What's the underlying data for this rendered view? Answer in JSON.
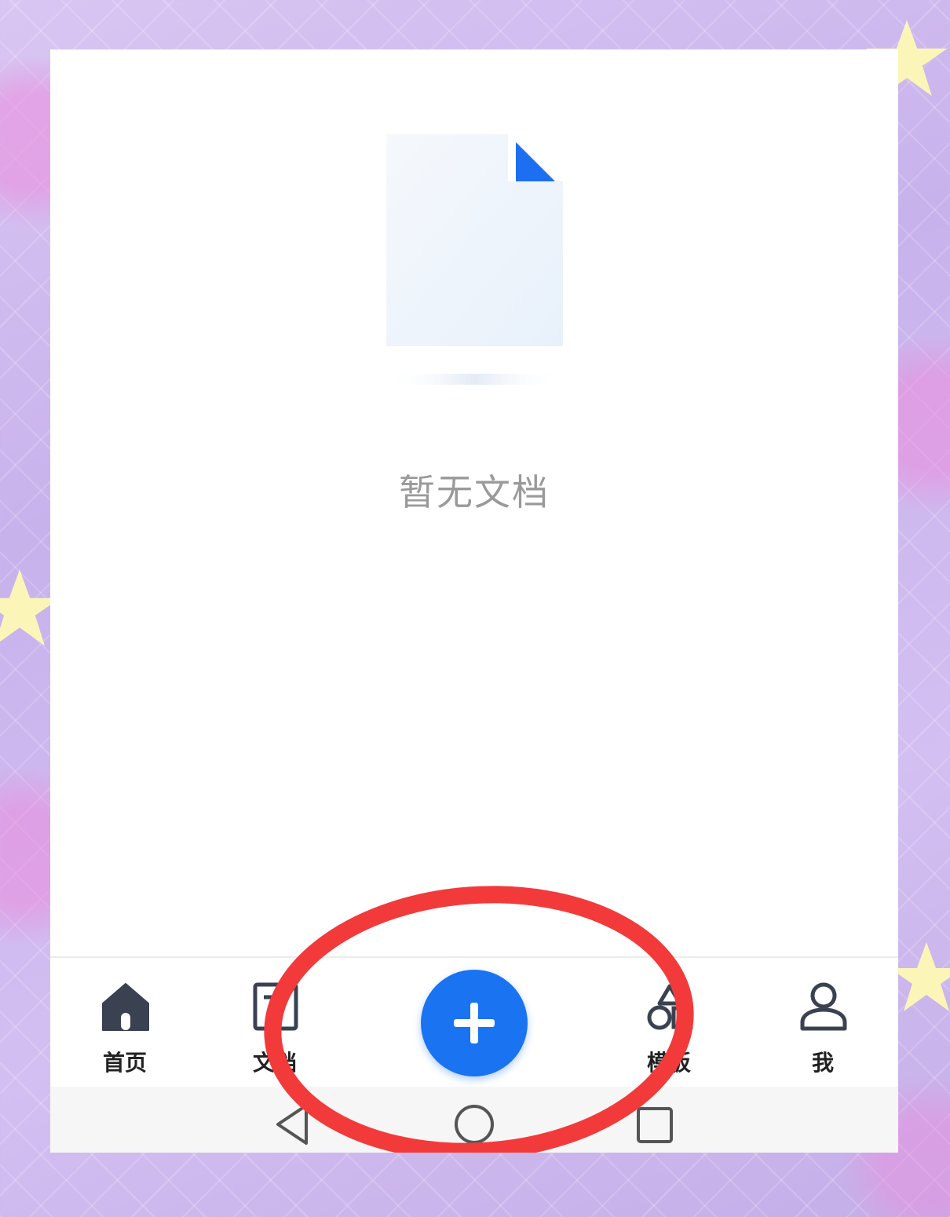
{
  "empty_state": {
    "message": "暂无文档",
    "icon": "empty-document-icon"
  },
  "tabbar": {
    "tabs": [
      {
        "id": "home",
        "label": "首页",
        "icon": "home-icon"
      },
      {
        "id": "docs",
        "label": "文档",
        "icon": "document-icon"
      },
      {
        "id": "templates",
        "label": "模板",
        "icon": "template-icon"
      },
      {
        "id": "me",
        "label": "我",
        "icon": "user-icon"
      }
    ],
    "create_button_icon": "plus-icon"
  },
  "system_nav": {
    "buttons": [
      "back-icon",
      "home-circle-icon",
      "recents-icon"
    ]
  },
  "colors": {
    "accent": "#1a73f0",
    "annotation": "#f23a3a",
    "empty_text": "#9a9a9a",
    "tab_icon": "#3a4150"
  }
}
